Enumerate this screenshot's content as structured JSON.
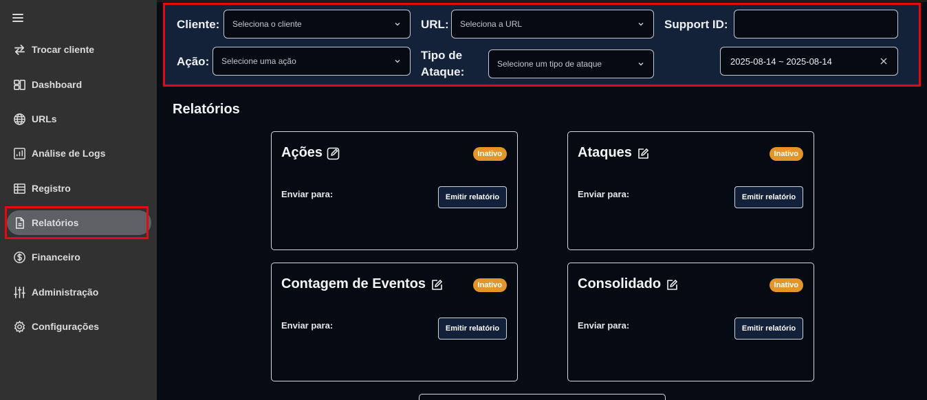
{
  "sidebar": {
    "items": [
      {
        "label": "Trocar cliente",
        "icon": "swap-arrows-icon"
      },
      {
        "label": "Dashboard",
        "icon": "dashboard-icon"
      },
      {
        "label": "URLs",
        "icon": "globe-icon"
      },
      {
        "label": "Análise de Logs",
        "icon": "chart-icon"
      },
      {
        "label": "Registro",
        "icon": "table-list-icon"
      },
      {
        "label": "Relatórios",
        "icon": "document-icon",
        "active": true
      },
      {
        "label": "Financeiro",
        "icon": "dollar-circle-icon"
      },
      {
        "label": "Administração",
        "icon": "sliders-icon"
      },
      {
        "label": "Configurações",
        "icon": "gear-icon"
      }
    ]
  },
  "filters": {
    "cliente_label": "Cliente:",
    "cliente_placeholder": "Seleciona o cliente",
    "url_label": "URL:",
    "url_placeholder": "Seleciona a URL",
    "support_label": "Support ID:",
    "support_value": "",
    "acao_label": "Ação:",
    "acao_placeholder": "Selecione uma ação",
    "tipo_label_line1": "Tipo de",
    "tipo_label_line2": "Ataque:",
    "tipo_placeholder": "Selecione um tipo de ataque",
    "date_range": "2025-08-14 ~ 2025-08-14"
  },
  "main": {
    "title": "Relatórios",
    "cards": [
      {
        "title": "Ações",
        "status": "Inativo",
        "send_label": "Enviar para:",
        "button": "Emitir relatório"
      },
      {
        "title": "Ataques",
        "status": "Inativo",
        "send_label": "Enviar para:",
        "button": "Emitir relatório"
      },
      {
        "title": "Contagem de Eventos",
        "status": "Inativo",
        "send_label": "Enviar para:",
        "button": "Emitir relatório"
      },
      {
        "title": "Consolidado",
        "status": "Inativo",
        "send_label": "Enviar para:",
        "button": "Emitir relatório"
      }
    ]
  },
  "colors": {
    "sidebar_bg": "#313131",
    "filter_bg": "#132238",
    "highlight": "#e50914",
    "badge": "#e3952a",
    "page_bg": "#070b13"
  }
}
